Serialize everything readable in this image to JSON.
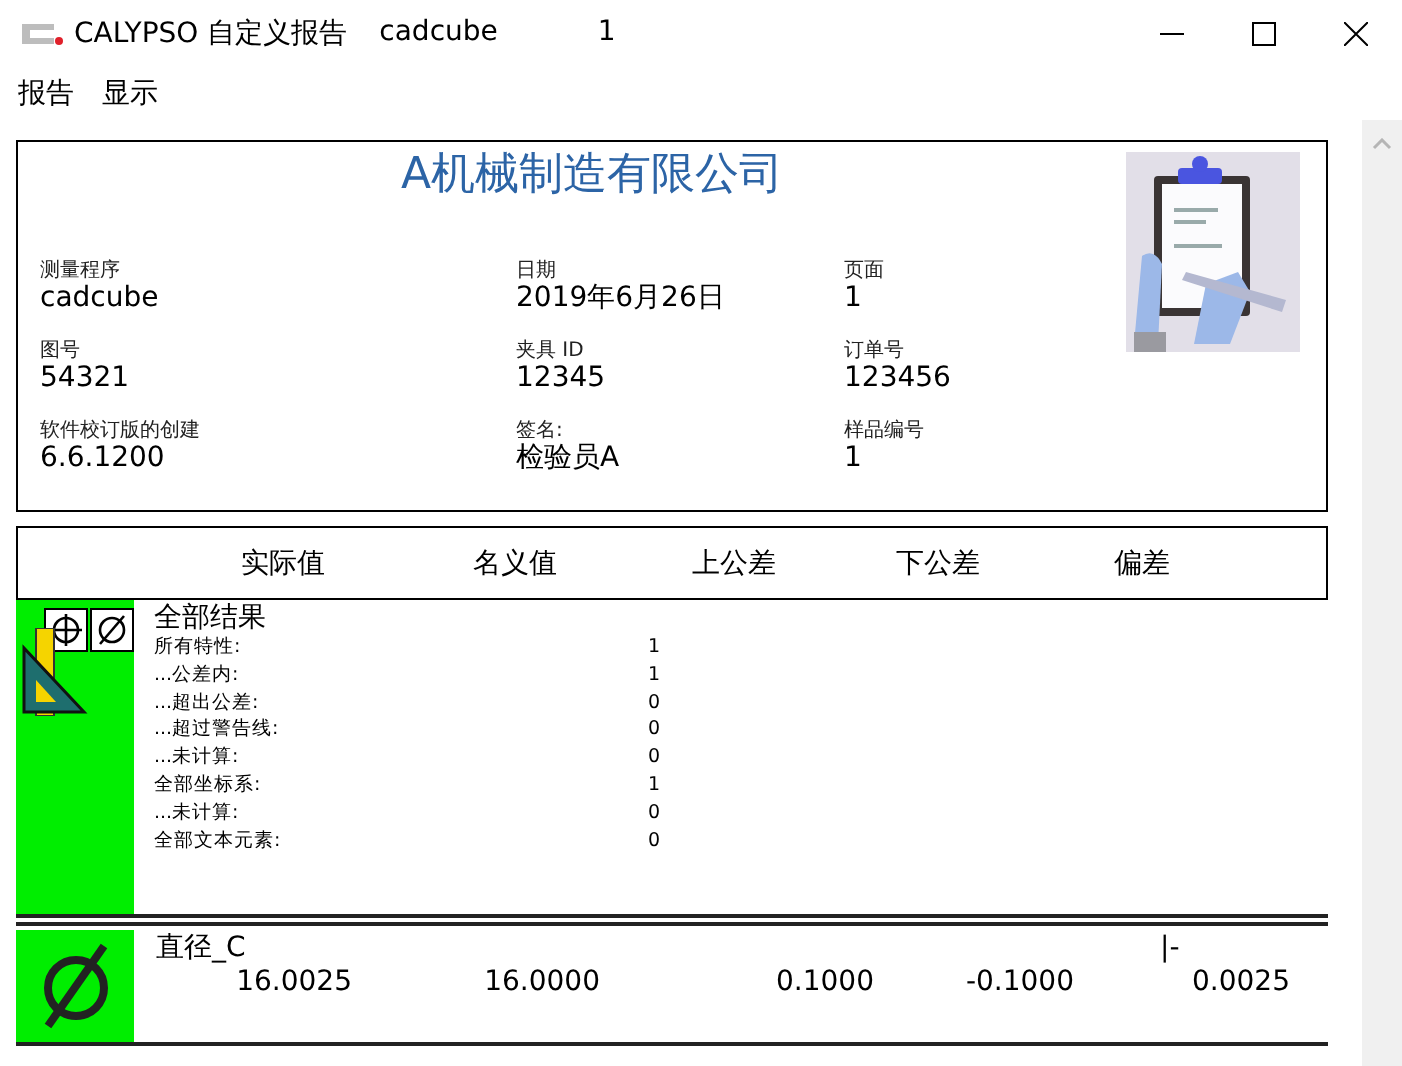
{
  "window": {
    "title_parts": [
      "CALYPSO 自定义报告",
      "cadcube",
      "1"
    ]
  },
  "menu": [
    {
      "label": "报告"
    },
    {
      "label": "显示"
    }
  ],
  "report": {
    "company": "A机械制造有限公司",
    "fields": [
      {
        "label": "测量程序",
        "value": "cadcube"
      },
      {
        "label": "日期",
        "value": "2019年6月26日"
      },
      {
        "label": "页面",
        "value": "1"
      },
      {
        "label": "图号",
        "value": "54321"
      },
      {
        "label": "夹具 ID",
        "value": "12345"
      },
      {
        "label": "订单号",
        "value": "123456"
      },
      {
        "label": "软件校订版的创建",
        "value": "6.6.1200"
      },
      {
        "label": "签名:",
        "value": "检验员A"
      },
      {
        "label": "样品编号",
        "value": "1"
      }
    ],
    "columns": [
      "实际值",
      "名义值",
      "上公差",
      "下公差",
      "偏差"
    ],
    "summary": {
      "title": "全部结果",
      "in_tolerance": true,
      "rows": [
        {
          "label": "所有特性:",
          "value": "1"
        },
        {
          "label": "...公差内:",
          "value": "1"
        },
        {
          "label": "...超出公差:",
          "value": "0"
        },
        {
          "label": "...超过警告线:",
          "value": "0"
        },
        {
          "label": "...未计算:",
          "value": "0"
        },
        {
          "label": "全部坐标系:",
          "value": "1"
        },
        {
          "label": "...未计算:",
          "value": "0"
        },
        {
          "label": "全部文本元素:",
          "value": "0"
        }
      ]
    },
    "features": [
      {
        "kind": "diameter",
        "in_tolerance": true,
        "name": "直径_C",
        "mark": "|-",
        "values": [
          "16.0025",
          "16.0000",
          "0.1000",
          "-0.1000",
          "0.0025"
        ]
      }
    ]
  }
}
